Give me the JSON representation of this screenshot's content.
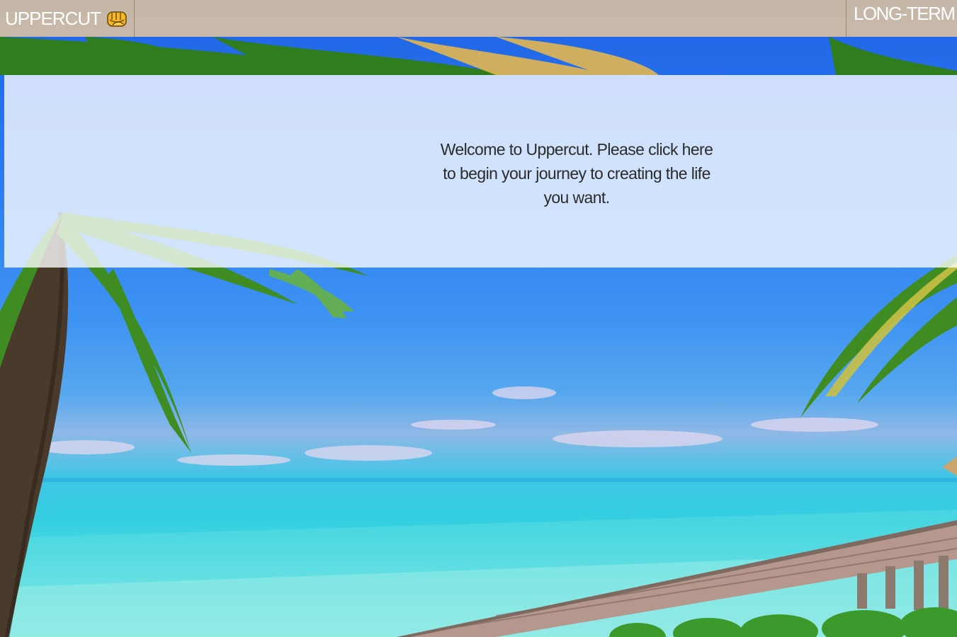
{
  "navbar": {
    "brand_label": "UPPERCUT",
    "brand_icon": "fist-icon",
    "right_link_label": "LONG-TERM"
  },
  "welcome": {
    "message": "Welcome to Uppercut. Please click here to begin your journey to creating the life you want."
  },
  "background": {
    "scene": "tropical-beach-icon",
    "colors": {
      "navbar": "#dec4a0",
      "sky_top": "#1e63e6",
      "sea": "#33d0e0",
      "panel": "#ffffff",
      "welcome_text": "#2b2b2b"
    }
  }
}
